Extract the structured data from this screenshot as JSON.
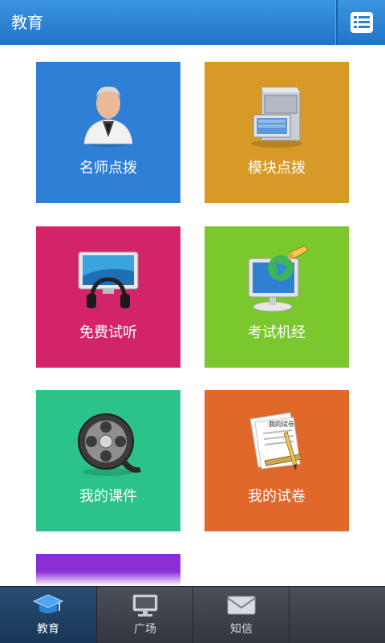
{
  "header": {
    "title": "教育",
    "menu_icon": "list-menu-icon"
  },
  "tiles": [
    {
      "label": "名师点拨",
      "color": "#2e7fd6",
      "icon": "teacher-icon"
    },
    {
      "label": "模块点拨",
      "color": "#d89a27",
      "icon": "file-cabinet-icon"
    },
    {
      "label": "免费试听",
      "color": "#d3246a",
      "icon": "monitor-headphones-icon"
    },
    {
      "label": "考试机经",
      "color": "#7ac72e",
      "icon": "computer-globe-icon"
    },
    {
      "label": "我的课件",
      "color": "#2cc38b",
      "icon": "film-reel-icon"
    },
    {
      "label": "我的试卷",
      "color": "#e0682a",
      "icon": "exam-paper-icon"
    }
  ],
  "partial_tile_color": "#8a2fd6",
  "exam_paper_text": "我的试卷",
  "tabs": [
    {
      "label": "教育",
      "icon": "graduation-cap-icon",
      "active": true
    },
    {
      "label": "广场",
      "icon": "computer-icon",
      "active": false
    },
    {
      "label": "知信",
      "icon": "envelope-icon",
      "active": false
    }
  ]
}
